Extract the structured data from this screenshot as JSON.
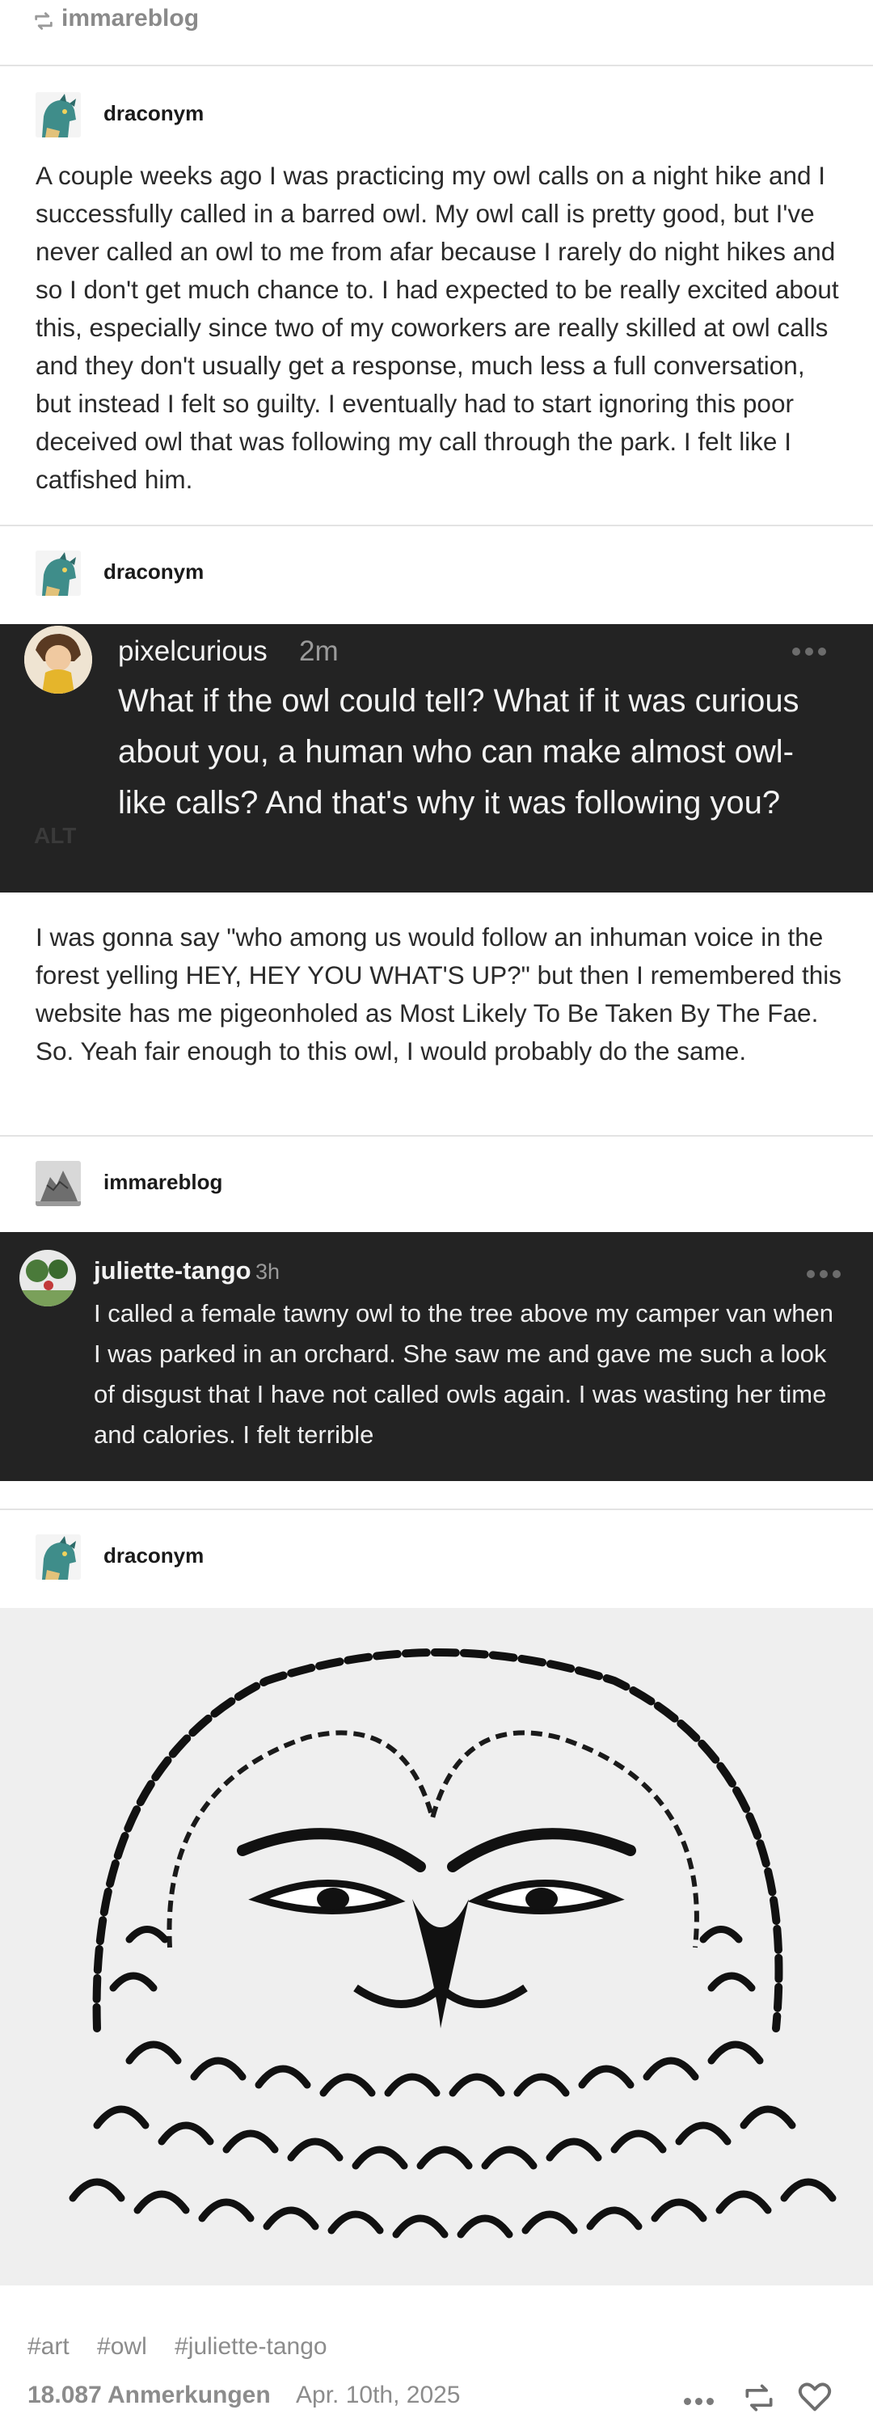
{
  "reblog_header": {
    "username": "immareblog",
    "icon": "reblog-icon"
  },
  "posts": [
    {
      "username": "draconym",
      "text": "A couple weeks ago I was practicing my owl calls on a night hike and I successfully called in a barred owl. My owl call is pretty good, but I've never called an owl to me from afar because I rarely do night hikes and so I don't get much chance to. I had expected to be really excited about this, especially since two of my coworkers are really skilled at owl calls and they don't usually get a response, much less a full conversation, but instead I felt so guilty. I eventually had to start ignoring this poor deceived owl that was following my call through the park. I felt like I catfished him."
    },
    {
      "username": "draconym",
      "screenshot": {
        "username": "pixelcurious",
        "time": "2m",
        "text": "What if the owl could tell? What if it was curious about you, a human who can make almost owl-like calls? And that's why it was following you?",
        "alt_label": "ALT"
      },
      "text": "I was gonna say \"who among us would follow an inhuman voice in the forest yelling HEY, HEY YOU WHAT'S UP?\" but then I remembered this website has me pigeonholed as Most Likely To Be Taken By The Fae. So. Yeah fair enough to this owl, I would probably do the same."
    },
    {
      "username": "immareblog",
      "screenshot": {
        "username": "juliette-tango",
        "time": "3h",
        "text": "I called a female tawny owl to the tree above my camper van when I was parked in an orchard. She saw me and gave me such a look of disgust that I have not called owls again. I was wasting her time and calories.  I felt terrible"
      }
    },
    {
      "username": "draconym",
      "image": "owl-ink-drawing"
    }
  ],
  "tags": [
    "#art",
    "#owl",
    "#juliette-tango"
  ],
  "footer": {
    "notes": "18.087 Anmerkungen",
    "date": "Apr. 10th, 2025",
    "icons": [
      "more-icon",
      "reblog-icon",
      "heart-icon"
    ]
  }
}
